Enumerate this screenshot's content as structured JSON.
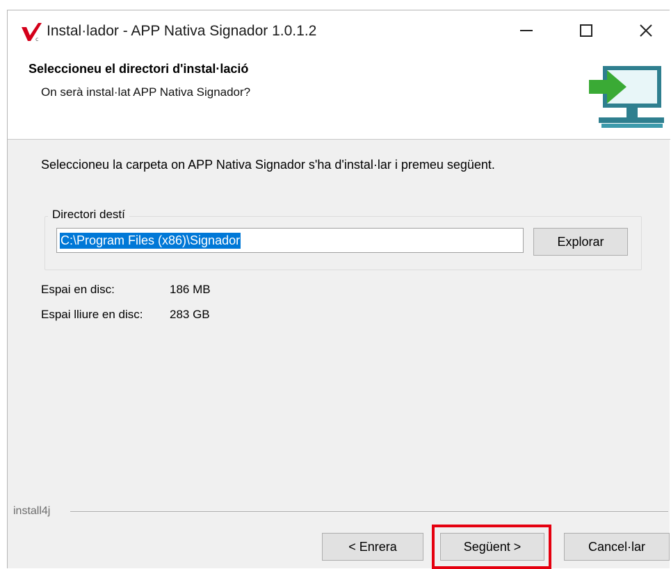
{
  "window": {
    "title": "Instal·lador - APP Nativa Signador 1.0.1.2",
    "controls": {
      "minimize": "—",
      "maximize": "☐",
      "close": "✕"
    }
  },
  "header": {
    "title": "Seleccioneu el directori d'instal·lació",
    "subtitle": "On serà instal·lat APP Nativa Signador?",
    "icon": "install-to-computer-icon"
  },
  "body": {
    "instruction": "Seleccioneu la carpeta on APP Nativa Signador s'ha d'instal·lar i premeu següent.",
    "destination_group": {
      "label": "Directori destí",
      "path_value": "C:\\Program Files (x86)\\Signador",
      "browse_label": "Explorar"
    },
    "disk_info": {
      "space_label": "Espai en disc:",
      "space_value": "186 MB",
      "free_label": "Espai lliure en disc:",
      "free_value": "283 GB"
    }
  },
  "footer": {
    "brand": "install4j",
    "back_label": "< Enrera",
    "next_label": "Següent >",
    "cancel_label": "Cancel·lar"
  },
  "colors": {
    "selection": "#0078d7",
    "highlight_box": "#e5000f",
    "icon_green": "#3aaa35",
    "icon_monitor": "#2f7f8f"
  }
}
